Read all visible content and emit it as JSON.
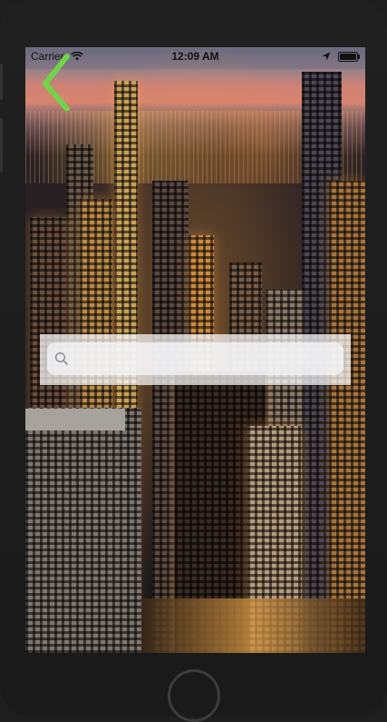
{
  "status_bar": {
    "carrier": "Carrier",
    "time": "12:09 AM",
    "wifi_icon": "wifi-icon",
    "location_icon": "location-arrow-icon",
    "battery_icon": "battery-icon"
  },
  "navigation": {
    "back_icon": "chevron-left-icon",
    "back_color": "#6fd44a"
  },
  "search": {
    "placeholder": "",
    "value": "",
    "icon": "magnifying-glass-icon"
  },
  "background": {
    "description_icon": "city-skyline-photo"
  },
  "device": {
    "home_button_icon": "home-button"
  }
}
